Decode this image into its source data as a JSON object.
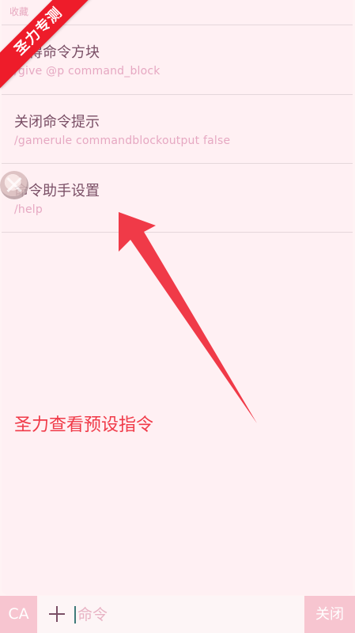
{
  "header": {
    "top_label": "收藏"
  },
  "badge": {
    "text": "圣力专测"
  },
  "presets": [
    {
      "title": "获得命令方块",
      "command": "/give  @p  command_block"
    },
    {
      "title": "关闭命令提示",
      "command": "/gamerule  commandblockoutput  false"
    },
    {
      "title": "命令助手设置",
      "command": "/help"
    }
  ],
  "annotation": {
    "text": "圣力查看预设指令",
    "color": "#f03a48"
  },
  "bottom_bar": {
    "ca_label": "CA",
    "input_placeholder": "命令",
    "close_label": "关闭"
  },
  "colors": {
    "accent_pink": "#f7c5d0",
    "badge_red": "#ee1c2a",
    "title_text": "#7a4f66",
    "command_text": "#e6a8c2"
  }
}
